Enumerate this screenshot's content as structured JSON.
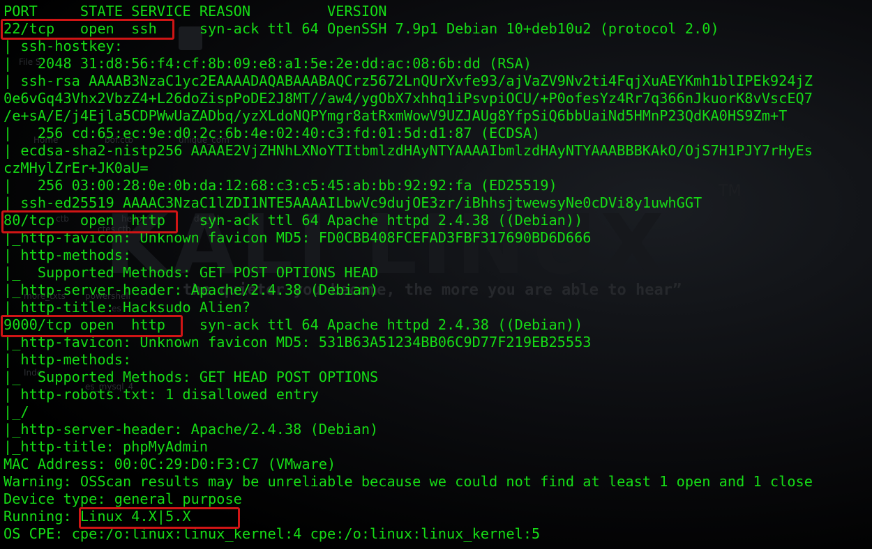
{
  "wallpaper": {
    "logo_text": "KALI LINUX",
    "trademark": "TM",
    "quote": "the quieter you become, the more you are able to hear”",
    "desktop_labels": [
      "File S",
      "Home",
      "bof.ctb",
      "unique_com",
      "ctb",
      "hello",
      "ctes.ctb",
      "de_tab",
      "Inde",
      "more_txts",
      "powershell",
      "es_mysql_4",
      "es"
    ]
  },
  "terminal": {
    "lines": [
      "PORT     STATE SERVICE REASON         VERSION",
      "22/tcp   open  ssh     syn-ack ttl 64 OpenSSH 7.9p1 Debian 10+deb10u2 (protocol 2.0)",
      "| ssh-hostkey: ",
      "|   2048 31:d8:56:f4:cf:8b:09:e8:a1:5e:2e:dd:ac:08:6b:dd (RSA)",
      "| ssh-rsa AAAAB3NzaC1yc2EAAAADAQABAAABAQCrz5672LnQUrXvfe93/ajVaZV9Nv2ti4FqjXuAEYKmh1blIPEk924jZ",
      "0e6vGq43Vhx2VbzZ4+L26doZispPoDE2J8MT//aw4/ygObX7xhhq1iPsvpiOCU/+P0ofesYz4Rr7q366nJkuorK8vVscEQ7",
      "/e+sA/E/j4Ejla5CDPWwUaZADbq/yzXLdoNQPYmgr8atRxmWowV9UZJAUg8YfpSiQ6bbUaiNd5HMnP23QdKA0HS9Zm+T",
      "|   256 cd:65:ec:9e:d0:2c:6b:4e:02:40:c3:fd:01:5d:d1:87 (ECDSA)",
      "| ecdsa-sha2-nistp256 AAAAE2VjZHNhLXNoYTItbmlzdHAyNTYAAAAIbmlzdHAyNTYAAABBBKAkO/OjS7H1PJY7rHyEs",
      "czMHylZrEr+JK0aU=",
      "|   256 03:00:28:0e:0b:da:12:68:c3:c5:45:ab:bb:92:92:fa (ED25519)",
      "| ssh-ed25519 AAAAC3NzaC1lZDI1NTE5AAAAILbwVc9dujOE3zr/iBhhsjtwewsyNe0cDVi8y1uwhGGT",
      "80/tcp   open  http    syn-ack ttl 64 Apache httpd 2.4.38 ((Debian))",
      "|_http-favicon: Unknown favicon MD5: FD0CBB408FCEFAD3FBF317690BD6D666",
      "| http-methods: ",
      "|_  Supported Methods: GET POST OPTIONS HEAD",
      "|_http-server-header: Apache/2.4.38 (Debian)",
      "|_http-title: Hacksudo Alien?",
      "9000/tcp open  http    syn-ack ttl 64 Apache httpd 2.4.38 ((Debian))",
      "|_http-favicon: Unknown favicon MD5: 531B63A51234BB06C9D77F219EB25553",
      "| http-methods: ",
      "|_  Supported Methods: GET HEAD POST OPTIONS",
      "| http-robots.txt: 1 disallowed entry ",
      "|_/",
      "|_http-server-header: Apache/2.4.38 (Debian)",
      "|_http-title: phpMyAdmin",
      "MAC Address: 00:0C:29:D0:F3:C7 (VMware)",
      "Warning: OSScan results may be unreliable because we could not find at least 1 open and 1 close",
      "Device type: general purpose",
      "Running: Linux 4.X|5.X",
      "OS CPE: cpe:/o:linux:linux_kernel:4 cpe:/o:linux:linux_kernel:5"
    ]
  },
  "colors": {
    "terminal_text": "#16dc16",
    "background": "#000000",
    "highlight_box": "#d01515"
  }
}
